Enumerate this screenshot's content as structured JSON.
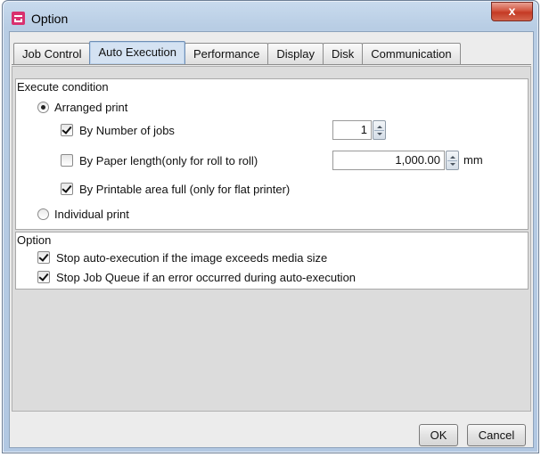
{
  "window": {
    "title": "Option",
    "close_glyph": "x"
  },
  "tabs": [
    {
      "label": "Job Control",
      "active": false
    },
    {
      "label": "Auto Execution",
      "active": true
    },
    {
      "label": "Performance",
      "active": false
    },
    {
      "label": "Display",
      "active": false
    },
    {
      "label": "Disk",
      "active": false
    },
    {
      "label": "Communication",
      "active": false
    }
  ],
  "execute_condition": {
    "title": "Execute condition",
    "arranged_print": {
      "label": "Arranged print",
      "selected": true
    },
    "by_number_of_jobs": {
      "label": "By Number of jobs",
      "checked": true,
      "value": "1"
    },
    "by_paper_length": {
      "label": "By Paper length(only for roll to roll)",
      "checked": false,
      "value": "1,000.00",
      "unit": "mm"
    },
    "by_printable_area": {
      "label": "By Printable area full (only for flat printer)",
      "checked": true
    },
    "individual_print": {
      "label": "Individual print",
      "selected": false
    }
  },
  "option": {
    "title": "Option",
    "stop_auto_execution": {
      "label": "Stop auto-execution if the image exceeds media size",
      "checked": true
    },
    "stop_job_queue": {
      "label": "Stop Job Queue if an error occurred during auto-execution",
      "checked": true
    }
  },
  "buttons": {
    "ok": "OK",
    "cancel": "Cancel"
  },
  "colors": {
    "active_tab": "#d4e2f2",
    "close_button": "#c43a24",
    "app_icon": "#d9316f"
  }
}
